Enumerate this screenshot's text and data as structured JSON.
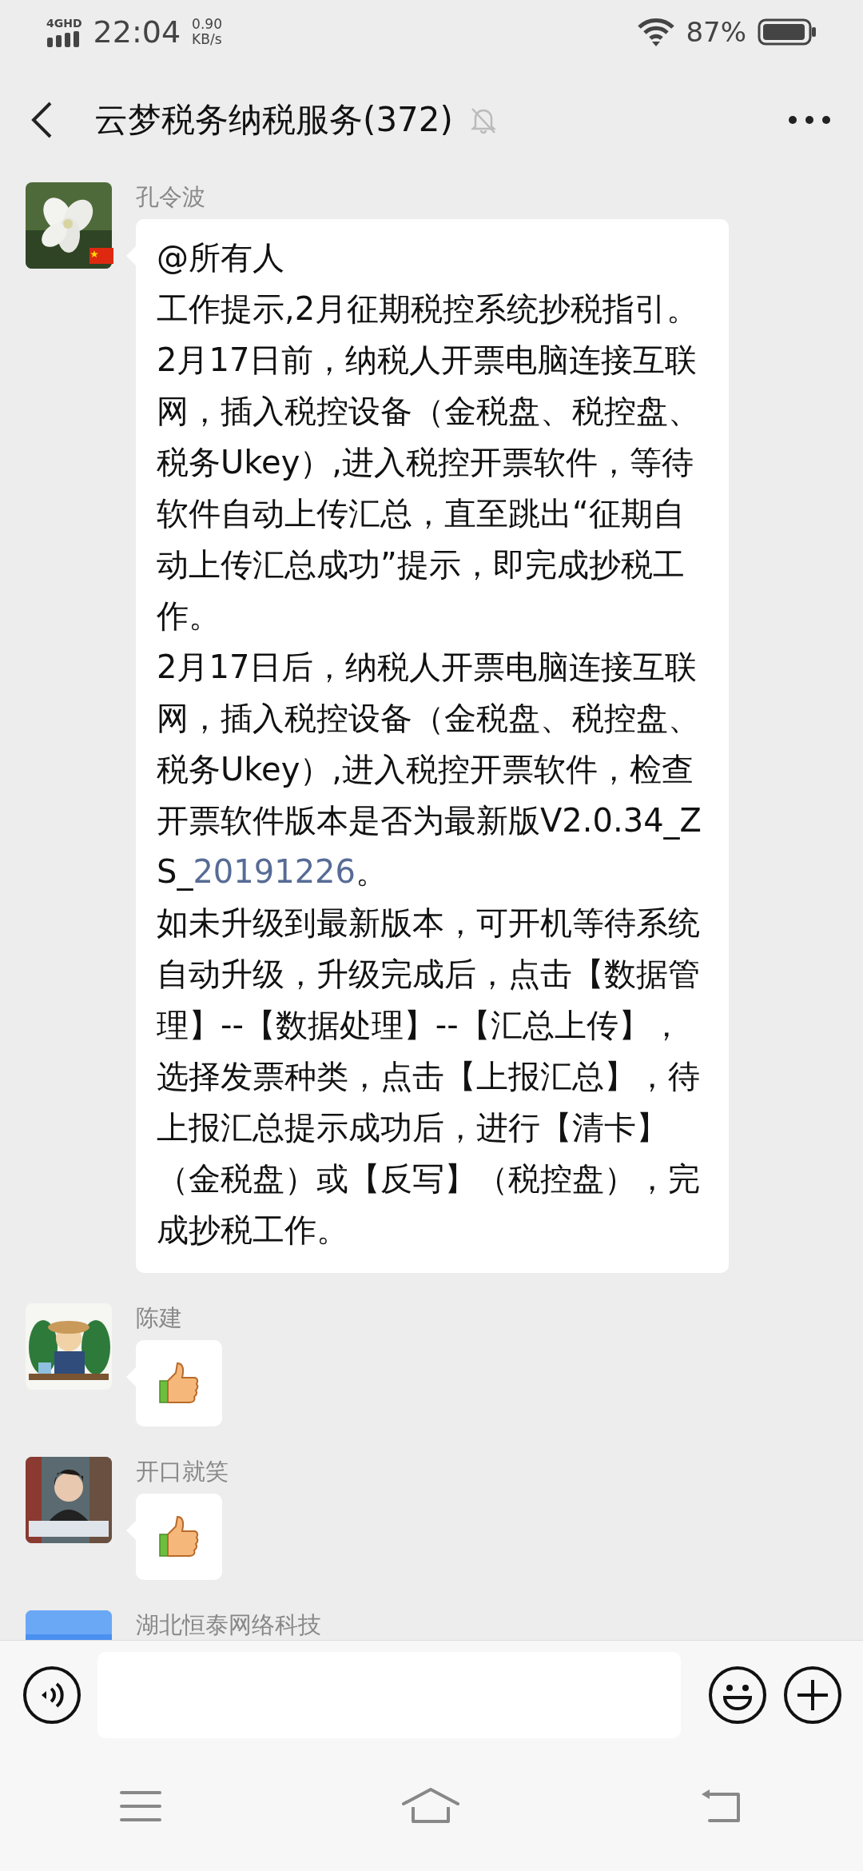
{
  "status_bar": {
    "network": "4GHD",
    "time": "22:04",
    "speed_value": "0.90",
    "speed_unit": "KB/s",
    "battery": "87%"
  },
  "header": {
    "title": "云梦税务纳税服务(372)",
    "muted": true
  },
  "messages": [
    {
      "sender": "孔令波",
      "flag_badge": true,
      "kind": "text",
      "paragraphs": [
        {
          "text": "@所有人"
        },
        {
          "text": "工作提示,2月征期税控系统抄税指引。2月17日前，纳税人开票电脑连接互联网，插入税控设备（金税盘、税控盘、税务Ukey）,进入税控开票软件，等待软件自动上传汇总，直至跳出“征期自动上传汇总成功”提示，即完成抄税工作。"
        },
        {
          "text": "2月17日后，纳税人开票电脑连接互联网，插入税控设备（金税盘、税控盘、税务Ukey）,进入税控开票软件，检查开票软件版本是否为最新版V2.0.34_ZS_",
          "link": "20191226",
          "after": "。"
        },
        {
          "text": "如未升级到最新版本，可开机等待系统自动升级，升级完成后，点击【数据管理】--【数据处理】--【汇总上传】，选择发票种类，点击【上报汇总】，待上报汇总提示成功后，进行【清卡】（金税盘）或【反写】（税控盘），完成抄税工作。"
        }
      ]
    },
    {
      "sender": "陈建",
      "flag_badge": false,
      "kind": "sticker"
    },
    {
      "sender": "开口就笑",
      "flag_badge": false,
      "kind": "sticker"
    },
    {
      "sender": "湖北恒泰网络科技",
      "flag_badge": false,
      "kind": "cut"
    }
  ]
}
